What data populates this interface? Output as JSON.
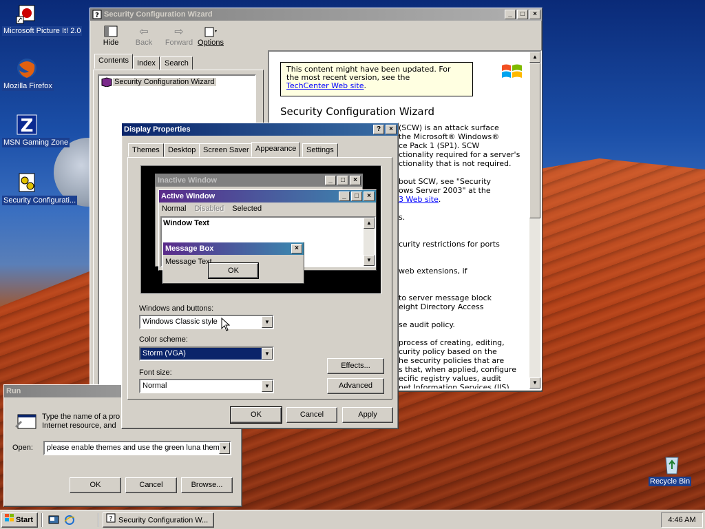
{
  "desktop": {
    "icons": [
      {
        "label": "Microsoft Picture It! 2.0"
      },
      {
        "label": "Mozilla Firefox"
      },
      {
        "label": "MSN Gaming Zone"
      },
      {
        "label": "Security Configurati..."
      },
      {
        "label": "Recycle Bin"
      }
    ]
  },
  "help_window": {
    "title": "Security Configuration Wizard",
    "toolbar": {
      "hide": "Hide",
      "back": "Back",
      "forward": "Forward",
      "options": "Options"
    },
    "tabs": [
      "Contents",
      "Index",
      "Search"
    ],
    "tree_item": "Security Configuration Wizard",
    "notice_line1": "This content might have been updated. For",
    "notice_line2": "the most recent version, see the",
    "notice_link": "TechCenter Web site",
    "notice_end": ".",
    "heading": "Security Configuration Wizard",
    "body_lines": [
      "(SCW) is an attack surface",
      "the Microsoft® Windows®",
      "ce Pack 1 (SP1). SCW",
      "ctionality required for a server's",
      "ctionality that is not required.",
      "",
      "bout SCW, see \"Security",
      "ows Server 2003\" at the",
      "3 Web site.",
      "",
      "s.",
      "",
      "",
      "curity restrictions for ports",
      "",
      "",
      "web extensions, if",
      "",
      "",
      "to server message block",
      "eight Directory Access",
      "",
      "se audit policy.",
      "",
      "process of creating, editing,",
      "curity policy based on the",
      "he security policies that are",
      "s that, when applied, configure",
      "ecific registry values, audit",
      "net Information Services (IIS)"
    ]
  },
  "display_properties": {
    "title": "Display Properties",
    "tabs": [
      "Themes",
      "Desktop",
      "Screen Saver",
      "Appearance",
      "Settings"
    ],
    "preview": {
      "inactive_title": "Inactive Window",
      "active_title": "Active Window",
      "menu_normal": "Normal",
      "menu_disabled": "Disabled",
      "menu_selected": "Selected",
      "window_text": "Window Text",
      "msgbox_title": "Message Box",
      "msgbox_text": "Message Text",
      "msgbox_ok": "OK"
    },
    "windows_buttons_label": "Windows and buttons:",
    "windows_buttons_value": "Windows Classic style",
    "color_scheme_label": "Color scheme:",
    "color_scheme_value": "Storm (VGA)",
    "font_size_label": "Font size:",
    "font_size_value": "Normal",
    "effects": "Effects...",
    "advanced": "Advanced",
    "ok": "OK",
    "cancel": "Cancel",
    "apply": "Apply"
  },
  "run_dialog": {
    "title": "Run",
    "desc_line1": "Type the name of a pro",
    "desc_line2": "Internet resource, and",
    "open_label": "Open:",
    "open_value": "please enable themes and use the green luna theme",
    "ok": "OK",
    "cancel": "Cancel",
    "browse": "Browse..."
  },
  "taskbar": {
    "start": "Start",
    "task": "Security Configuration W...",
    "clock": "4:46 AM"
  },
  "colors": {
    "active_title": "#0a246a",
    "storm_title": "#5a2a8a",
    "selected_field": "#0a246a"
  }
}
